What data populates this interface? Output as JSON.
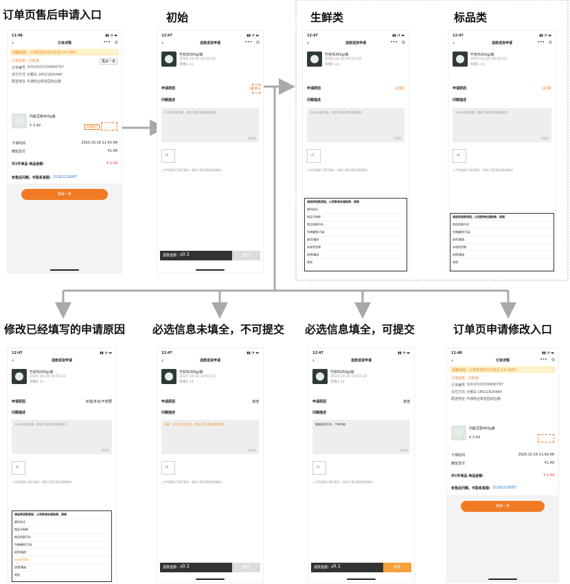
{
  "captions": {
    "entry": "订单页售后申请入口",
    "initial": "初始",
    "fresh": "生鲜类",
    "standard": "标品类",
    "modify_reason": "修改已经填写的申请原因",
    "incomplete": "必选信息未填全，不可提交",
    "complete": "必选信息填全，可提交",
    "modify_entry": "订单页申请修改入口"
  },
  "order_screen": {
    "time": "11:48",
    "title": "订单详情",
    "banner": "温馨提醒：订单配送时间已延至(14-18时)",
    "status_label": "订单状态：已收货",
    "order_no_label": "订单编号",
    "order_no": "32010101530690767",
    "pay_label": "支付方式",
    "pay_value": "大额白 18521826484",
    "addr_label": "配送地址",
    "addr_value": "中通商业街花园商业路",
    "product_name": "内脏豆腐400g装",
    "product_price": "¥ 3.49",
    "order_time_label": "下单时间",
    "order_time": "2020.10.19 11:42:09",
    "paid_label": "微信支付",
    "paid_value": "¥1.49",
    "total_label": "共1件商品 商品金额:",
    "total_value": "¥ 1.49",
    "phone_label": "有售后问题，可联系客服:",
    "phone": "15262219097",
    "button": "再来一单",
    "after_sale": "申请售后"
  },
  "apply_screen": {
    "time": "12:47",
    "title": "退款退货申请",
    "product_name": "竹荪鸡350g/袋",
    "product_date": "2020-10-19 10:53:22",
    "product_spec": "规格1  x1",
    "reason_label": "申请原因",
    "reason_required": "(必填)",
    "reason_selected_a": "买错/多买/不想要",
    "reason_selected_b": "其他",
    "desc_label": "问题描述",
    "desc_placeholder": "不允许描述问题，帮助于我们更快速地解决",
    "desc_placeholder_warn": "温馨：不允许描述问题，帮助于我们更快速地解决",
    "desc_filled": "跟描述的不符，下单鸡肉",
    "desc_count": "0/300",
    "photo_label": "上传图片",
    "hint": "上传凭据便于我们更快，帮助于我们更快速地解决",
    "refund_label": "退款金额：¥",
    "refund_value": "0.1",
    "submit": "提交"
  },
  "reason_lists": {
    "header": "请选择退款原因，以免影响处理结果，谢谢",
    "fresh": [
      "超时送达",
      "商品不新鲜",
      "商品质量不佳",
      "包装破损/污染",
      "缺货/漏发",
      "未收到货物",
      "送错/漏送",
      "其他"
    ],
    "standard": [
      "商品质量不佳",
      "包装破损/污染",
      "缺货/漏发",
      "未收到货物",
      "送错/漏送",
      "其他"
    ],
    "modify": [
      "超时送达",
      "商品不新鲜",
      "商品质量不佳",
      "包装破损/污染",
      "缺货/漏发",
      "未收到货物",
      "送错/漏送",
      "其他"
    ]
  },
  "icons": {
    "back": "chevron-left-icon",
    "camera": "camera-icon",
    "more": "more-icon",
    "target": "target-icon"
  },
  "colors": {
    "accent": "#f07b24",
    "warn": "#f5a03a",
    "arrow": "#a9a9a9"
  }
}
